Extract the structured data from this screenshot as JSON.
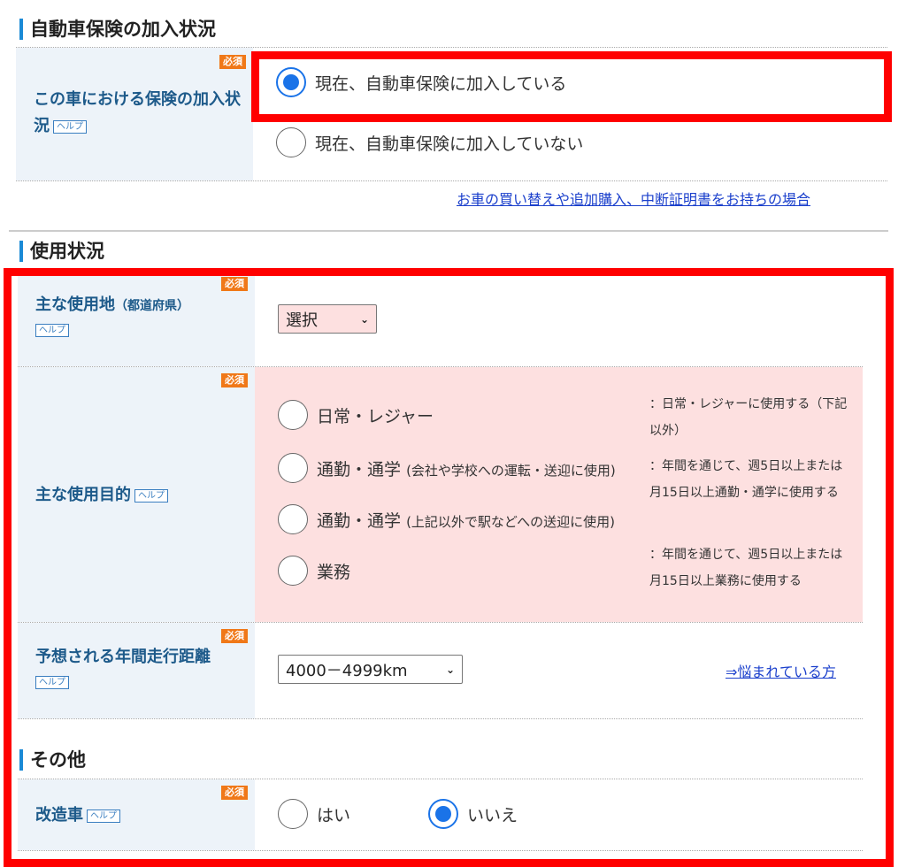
{
  "required_badge": "必須",
  "help_badge": "ヘルプ",
  "insurance": {
    "section_title": "自動車保険の加入状況",
    "label": "この車における保険の加入状況",
    "options": [
      {
        "label": "現在、自動車保険に加入している",
        "checked": true
      },
      {
        "label": "現在、自動車保険に加入していない",
        "checked": false
      }
    ],
    "link": "お車の買い替えや追加購入、中断証明書をお持ちの場合"
  },
  "usage": {
    "section_title": "使用状況",
    "location": {
      "label": "主な使用地",
      "sub_label": "（都道府県）",
      "selected": "選択"
    },
    "purpose": {
      "label": "主な使用目的",
      "options": [
        {
          "label": "日常・レジャー",
          "note": ""
        },
        {
          "label": "通勤・通学",
          "note": "(会社や学校への運転・送迎に使用)"
        },
        {
          "label": "通勤・通学",
          "note": "(上記以外で駅などへの送迎に使用)"
        },
        {
          "label": "業務",
          "note": ""
        }
      ],
      "descriptions": [
        "：日常・レジャーに使用する（下記以外）",
        "：年間を通じて、週5日以上または月15日以上通勤・通学に使用する",
        "：年間を通じて、週5日以上または月15日以上業務に使用する"
      ]
    },
    "mileage": {
      "label": "予想される年間走行距離",
      "selected": "4000－4999km",
      "link": "⇒悩まれている方"
    }
  },
  "other": {
    "section_title": "その他",
    "modified": {
      "label": "改造車",
      "options": [
        {
          "label": "はい",
          "checked": false
        },
        {
          "label": "いいえ",
          "checked": true
        }
      ]
    }
  },
  "colors": {
    "highlight": "#ff0000",
    "accent": "#1a73e8",
    "label_text": "#1d5a8a",
    "required": "#f07818"
  }
}
